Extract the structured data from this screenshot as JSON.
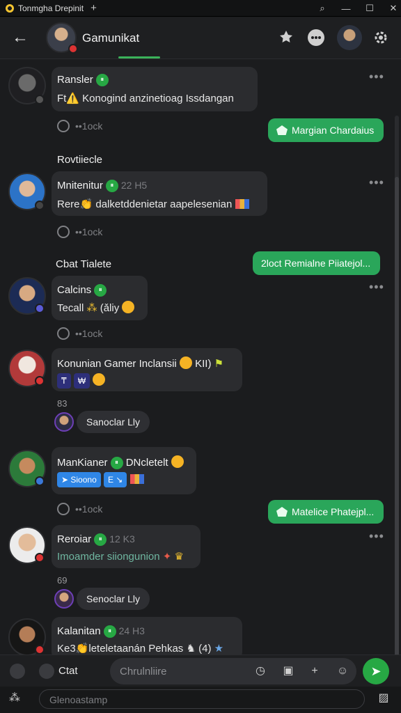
{
  "window": {
    "title": "Tonmgha Drepinit",
    "new_tab": "+",
    "controls": {
      "search": "⌕",
      "minimize": "—",
      "maximize": "☐",
      "close": "✕"
    }
  },
  "header": {
    "back": "←",
    "group_name": "Gamunikat",
    "icons": [
      "pin-icon",
      "more-icon",
      "profile-avatar",
      "settings-icon"
    ]
  },
  "messages": [
    {
      "name": "Ransler",
      "text": "Ft⚠️ Konogind anzinetioag Issdangan"
    },
    {
      "clock": "••1ock"
    },
    {
      "outgoing": "Margian Chardaius"
    },
    {
      "section": "Rovtiiecle"
    },
    {
      "name": "Mnitenitur",
      "meta": "22 H5",
      "text": "Rere👏 dalketddenietar aapelesenian"
    },
    {
      "clock": "••1ock"
    },
    {
      "outgoing": "2loct Remialne Piiatejol..."
    },
    {
      "section": "Cbat Tialete"
    },
    {
      "name": "Calcins",
      "text": "Tecall",
      "text2": "(ǎliy"
    },
    {
      "clock": "••1ock"
    },
    {
      "name": "Konunian Gamer Inclansii",
      "meta": "KII)",
      "chip1": "₸",
      "chip2": "₩"
    },
    {
      "count": "83"
    },
    {
      "pill": "Sanoclar Lly"
    },
    {
      "name": "ManKianer",
      "text_after_check": "DNcletelt",
      "chip_a": "Sioono",
      "chip_b": "E ↘"
    },
    {
      "clock": "••1ock"
    },
    {
      "outgoing": "Matelice Phatejpl..."
    },
    {
      "name": "Reroiar",
      "meta": "12 K3",
      "text": "Imoamder siiongunion"
    },
    {
      "count": "69"
    },
    {
      "pill": "Senoclar Lly"
    },
    {
      "name": "Kalanitan",
      "meta": "24 H3",
      "text": "Ke3👏leteletaanán Pehkas",
      "tail": "(4)"
    }
  ],
  "composer": {
    "label": "Ctat",
    "placeholder": "Chrulnliire"
  },
  "bottom": {
    "placeholder": "Glenoastamp"
  }
}
